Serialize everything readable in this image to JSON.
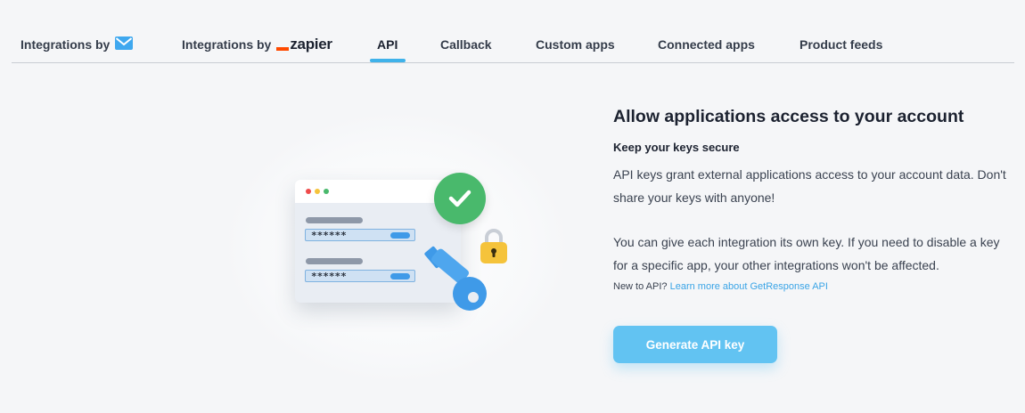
{
  "tabs": [
    {
      "label": "Integrations by",
      "icon": "envelope-icon",
      "active": false
    },
    {
      "label": "Integrations by",
      "brand": "zapier",
      "active": false
    },
    {
      "label": "API",
      "active": true
    },
    {
      "label": "Callback",
      "active": false
    },
    {
      "label": "Custom apps",
      "active": false
    },
    {
      "label": "Connected apps",
      "active": false
    },
    {
      "label": "Product feeds",
      "active": false
    }
  ],
  "illustration": {
    "masked_key": "******",
    "icons": [
      "browser-window-icon",
      "checkmark-icon",
      "padlock-icon",
      "key-icon"
    ]
  },
  "main": {
    "title": "Allow applications access to your account",
    "subtitle": "Keep your keys secure",
    "paragraph1": "API keys grant external applications access to your account data. Don't share your keys with anyone!",
    "paragraph2": "You can give each integration its own key. If you need to disable a key for a specific app, your other integrations won't be affected.",
    "learn_prefix": "New to API?",
    "learn_link": "Learn more about GetResponse API",
    "generate_button": "Generate API key"
  },
  "colors": {
    "accent": "#3fb2ea",
    "button": "#62c3f2",
    "success": "#49b96c",
    "lock": "#f5c33b",
    "key": "#3f9ae8",
    "zapier": "#ff4a00"
  }
}
